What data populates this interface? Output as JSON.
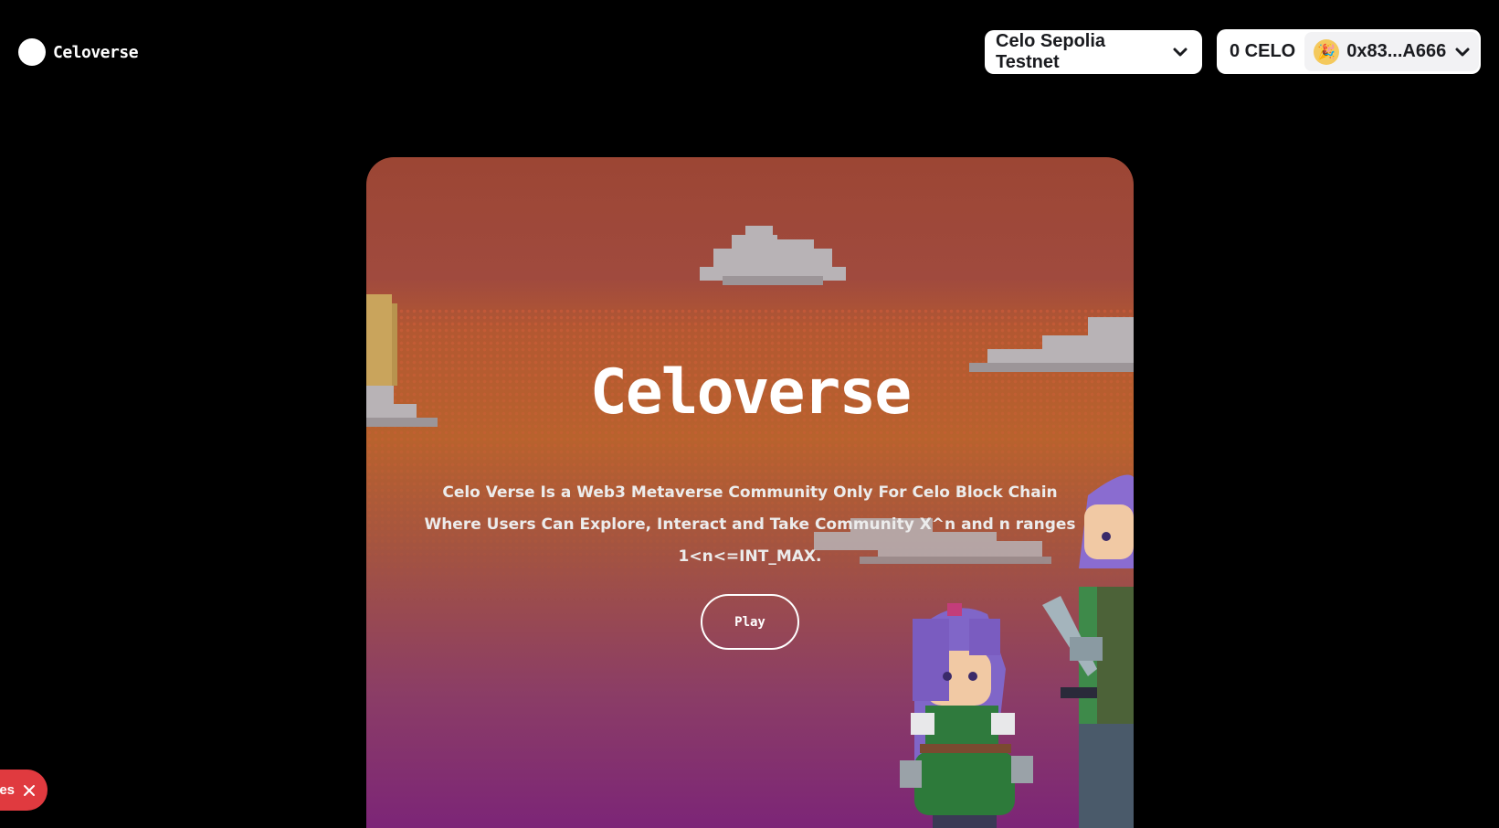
{
  "header": {
    "brand_name": "Celoverse",
    "network_label": "Celo Sepolia Testnet",
    "wallet": {
      "balance": "0 CELO",
      "address": "0x83...A666",
      "avatar_emoji": "🎉"
    }
  },
  "hero": {
    "title": "Celoverse",
    "description": "Celo Verse Is a Web3 Metaverse Community Only For Celo Block Chain Where Users Can Explore, Interact and Take Community X^n and n ranges 1<n<=INT_MAX.",
    "play_label": "Play"
  },
  "toast": {
    "text": "es"
  },
  "colors": {
    "toast_bg": "#e03a3f",
    "hero_top": "#9c4634",
    "hero_bottom": "#7c2577"
  }
}
